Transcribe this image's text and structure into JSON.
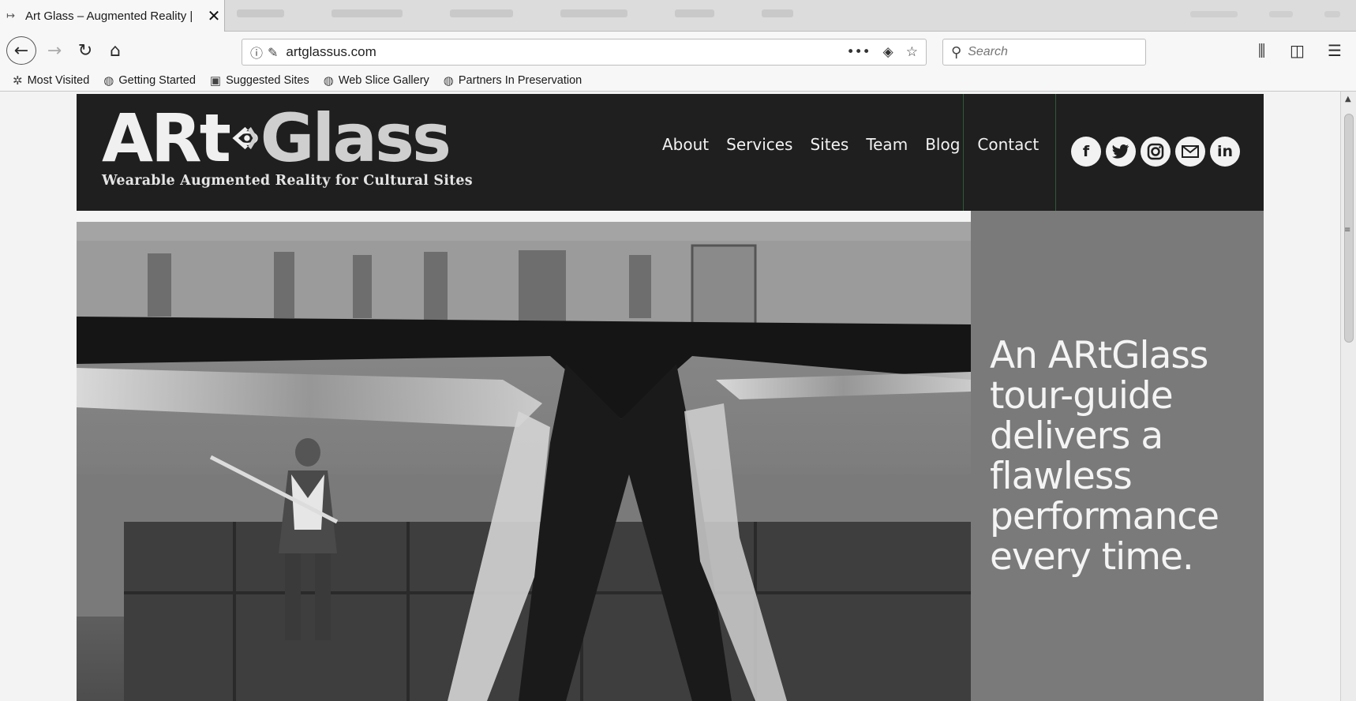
{
  "browser": {
    "tab_title": "Art Glass – Augmented Reality |",
    "url": "artglassus.com",
    "search_placeholder": "Search"
  },
  "bookmarks": [
    {
      "label": "Most Visited",
      "icon": "gear-icon"
    },
    {
      "label": "Getting Started",
      "icon": "globe-icon"
    },
    {
      "label": "Suggested Sites",
      "icon": "page-icon"
    },
    {
      "label": "Web Slice Gallery",
      "icon": "globe-icon"
    },
    {
      "label": "Partners In Preservation",
      "icon": "globe-icon"
    }
  ],
  "site": {
    "logo_part1": "ARt",
    "logo_part2": "Glass",
    "tagline": "Wearable Augmented Reality for Cultural Sites",
    "nav": [
      "About",
      "Services",
      "Sites",
      "Team",
      "Blog",
      "Contact"
    ],
    "social": [
      {
        "name": "facebook-icon",
        "glyph": "f"
      },
      {
        "name": "twitter-icon",
        "glyph": "🐦"
      },
      {
        "name": "instagram-icon",
        "glyph": "◘"
      },
      {
        "name": "email-icon",
        "glyph": "✉"
      },
      {
        "name": "linkedin-icon",
        "glyph": "in"
      }
    ],
    "hero_headline": "An ARtGlass tour-guide delivers a flawless performance every time."
  },
  "colors": {
    "header_bg": "#1f1f1f",
    "hero_panel": "#7a7a7a",
    "chrome_bg": "#f7f7f7"
  }
}
